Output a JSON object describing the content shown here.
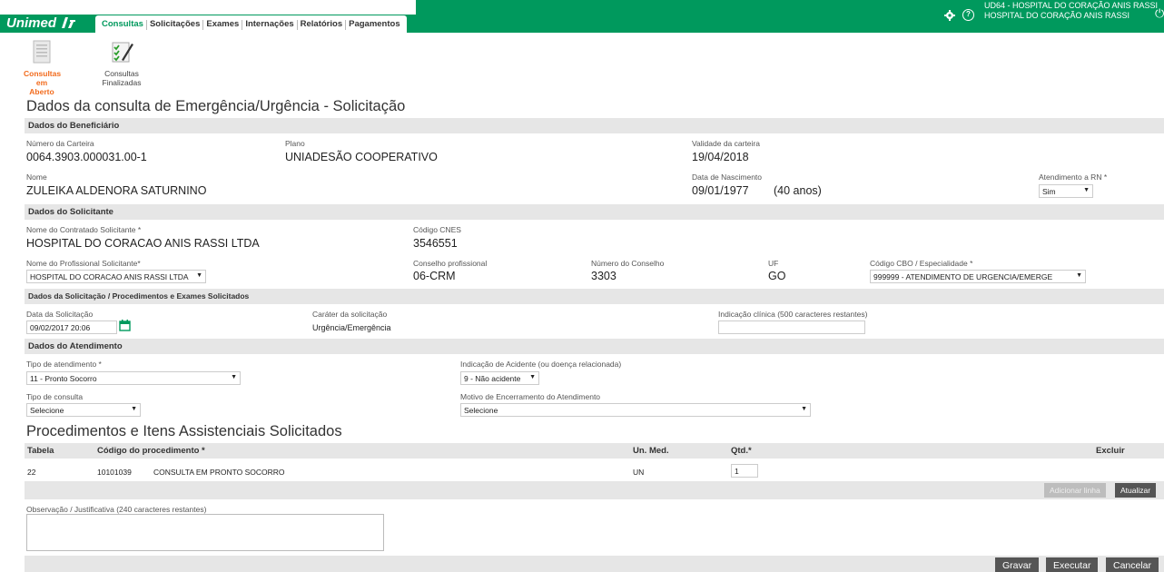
{
  "header": {
    "logo_text": "Unimed",
    "tabs": [
      "Consultas",
      "Solicitações",
      "Exames",
      "Internações",
      "Relatórios",
      "Pagamentos"
    ],
    "hospital_line1": "UD64 - HOSPITAL DO CORAÇÃO ANIS RASSI",
    "hospital_line2": "HOSPITAL DO CORAÇÃO ANIS RASSI",
    "brand_color": "#00995d"
  },
  "subnav": {
    "open_label_1": "Consultas em",
    "open_label_2": "Aberto",
    "done_label_1": "Consultas",
    "done_label_2": "Finalizadas"
  },
  "page_title": "Dados da consulta de Emergência/Urgência - Solicitação",
  "beneficiario": {
    "section": "Dados do Beneficiário",
    "carteira_label": "Número da Carteira",
    "carteira": "0064.3903.000031.00-1",
    "plano_label": "Plano",
    "plano": "UNIADESÃO COOPERATIVO",
    "validade_label": "Validade da carteira",
    "validade": "19/04/2018",
    "nome_label": "Nome",
    "nome": "ZULEIKA ALDENORA SATURNINO",
    "nascimento_label": "Data de Nascimento",
    "nascimento": "09/01/1977",
    "idade": "(40 anos)",
    "rn_label": "Atendimento a RN *",
    "rn_value": "Sim"
  },
  "solicitante": {
    "section": "Dados do Solicitante",
    "contratado_label": "Nome do Contratado Solicitante *",
    "contratado": "HOSPITAL DO CORACAO ANIS RASSI LTDA",
    "cnes_label": "Código CNES",
    "cnes": "3546551",
    "profissional_label": "Nome do Profissional Solicitante*",
    "profissional": "HOSPITAL DO CORACAO ANIS RASSI LTDA",
    "conselho_label": "Conselho profissional",
    "conselho": "06-CRM",
    "numero_conselho_label": "Número do Conselho",
    "numero_conselho": "3303",
    "uf_label": "UF",
    "uf": "GO",
    "cbo_label": "Código CBO / Especialidade *",
    "cbo": "999999 - ATENDIMENTO DE URGENCIA/EMERGE"
  },
  "solicitacao": {
    "section": "Dados da Solicitação / Procedimentos e Exames Solicitados",
    "data_label": "Data da Solicitação",
    "data": "09/02/2017 20:06",
    "carater_label": "Caráter da solicitação",
    "carater": "Urgência/Emergência",
    "indicacao_label": "Indicação clínica (500 caracteres restantes)"
  },
  "atendimento": {
    "section": "Dados do Atendimento",
    "tipo_label": "Tipo de atendimento *",
    "tipo": "11 - Pronto Socorro",
    "acidente_label": "Indicação de Acidente (ou doença relacionada)",
    "acidente": "9 - Não acidente",
    "consulta_label": "Tipo de consulta",
    "consulta": "Selecione",
    "motivo_label": "Motivo de Encerramento do Atendimento",
    "motivo": "Selecione"
  },
  "procedimentos": {
    "title": "Procedimentos e Itens Assistenciais Solicitados",
    "columns": [
      "Tabela",
      "Código do procedimento *",
      "Un. Med.",
      "Qtd.*",
      "Excluir"
    ],
    "rows": [
      {
        "tabela": "22",
        "codigo": "10101039",
        "descricao": "CONSULTA EM PRONTO SOCORRO",
        "un": "UN",
        "qtd": "1"
      }
    ],
    "add_button": "Adicionar linha",
    "update_button": "Atualizar"
  },
  "observacao_label": "Observação / Justificativa (240 caracteres restantes)",
  "footer": {
    "gravar": "Gravar",
    "executar": "Executar",
    "cancelar": "Cancelar"
  }
}
